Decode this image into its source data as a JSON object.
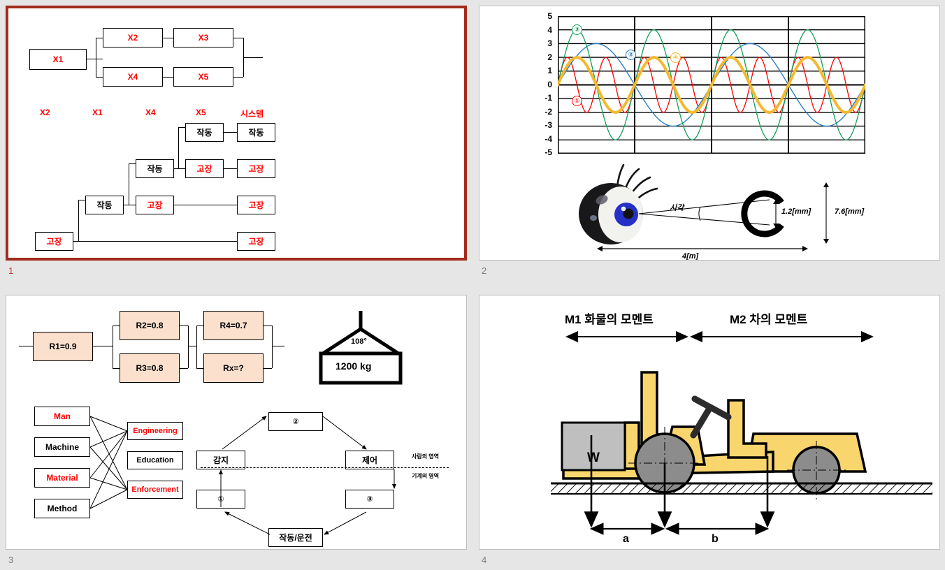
{
  "app": {
    "view": "slide-sorter",
    "background": "#e6e6e6",
    "selection_color": "#a32b1c"
  },
  "slides": [
    {
      "number": "1",
      "selected": true,
      "title": "Reliability block diagram and fault tree",
      "rbd": {
        "blocks": [
          "X1",
          "X2",
          "X3",
          "X4",
          "X5"
        ],
        "text_color": "#ff0000"
      },
      "tree": {
        "headers": [
          "X2",
          "X1",
          "X4",
          "X5",
          "시스템"
        ],
        "ok_label": "작동",
        "fail_label": "고장",
        "nodes": [
          {
            "col": "X5",
            "label": "작동",
            "state": "ok"
          },
          {
            "col": "system",
            "label": "작동",
            "state": "ok"
          },
          {
            "col": "X4",
            "label": "작동",
            "state": "ok"
          },
          {
            "col": "X5",
            "label": "고장",
            "state": "fail"
          },
          {
            "col": "system",
            "label": "고장",
            "state": "fail"
          },
          {
            "col": "X1",
            "label": "작동",
            "state": "ok"
          },
          {
            "col": "X4",
            "label": "고장",
            "state": "fail"
          },
          {
            "col": "system",
            "label": "고장",
            "state": "fail"
          },
          {
            "col": "X2",
            "label": "고장",
            "state": "fail"
          },
          {
            "col": "system",
            "label": "고장",
            "state": "fail"
          }
        ]
      }
    },
    {
      "number": "2",
      "selected": false,
      "title": "Waveforms and visual angle",
      "eye": {
        "angle_label": "시각",
        "gap_label": "1.2[mm]",
        "ring_label": "7.6[mm]",
        "distance_label": "4[m]"
      }
    },
    {
      "number": "3",
      "selected": false,
      "title": "Reliability network, sling load and 4M-3E",
      "rbd": {
        "blocks": [
          {
            "id": "R1",
            "label": "R1=0.9"
          },
          {
            "id": "R2",
            "label": "R2=0.8"
          },
          {
            "id": "R3",
            "label": "R3=0.8"
          },
          {
            "id": "R4",
            "label": "R4=0.7"
          },
          {
            "id": "Rx",
            "label": "Rx=?"
          }
        ]
      },
      "sling": {
        "angle": "108°",
        "load": "1200 kg"
      },
      "fourm": {
        "left": [
          {
            "label": "Man",
            "color": "#ff0000"
          },
          {
            "label": "Machine",
            "color": "#000000"
          },
          {
            "label": "Material",
            "color": "#ff0000"
          },
          {
            "label": "Method",
            "color": "#000000"
          }
        ],
        "right": [
          {
            "label": "Engineering",
            "color": "#ff0000"
          },
          {
            "label": "Education",
            "color": "#000000"
          },
          {
            "label": "Enforcement",
            "color": "#ff0000"
          }
        ]
      },
      "loop": {
        "top": "②",
        "left_upper": "감지",
        "right_upper": "제어",
        "left_lower": "①",
        "right_lower": "③",
        "bottom": "작동/운전",
        "human_zone": "사람의 영역",
        "machine_zone": "기계의 영역"
      }
    },
    {
      "number": "4",
      "selected": false,
      "title": "Forklift moment balance",
      "forklift": {
        "m1_label": "M1 화물의 모멘트",
        "m2_label": "M2 차의 모멘트",
        "load_label": "W",
        "dim_a": "a",
        "dim_b": "b",
        "body_color": "#f9d56e",
        "wheel_color": "#8c8c8c",
        "load_color": "#bfbfbf"
      }
    }
  ],
  "chart_data": {
    "type": "line",
    "title": "",
    "xlabel": "",
    "ylabel": "",
    "ylim": [
      -5,
      5
    ],
    "yticks": [
      5,
      4,
      3,
      2,
      1,
      0,
      -1,
      -2,
      -3,
      -4,
      -5
    ],
    "grid": true,
    "legend_position": "inline-annotations",
    "series": [
      {
        "name": "①",
        "label": "1",
        "color": "#ff0000",
        "amplitude": 2,
        "cycles": 8,
        "phase": 0,
        "width": 1.3
      },
      {
        "name": "②",
        "label": "2",
        "color": "#1f77c4",
        "amplitude": 3,
        "cycles": 2,
        "phase": 0,
        "width": 1.3
      },
      {
        "name": "③",
        "label": "3",
        "color": "#13a05c",
        "amplitude": 4,
        "cycles": 4,
        "phase": 0,
        "width": 1.3
      },
      {
        "name": "④",
        "label": "4",
        "color": "#ffc countries",
        "amplitude": 2,
        "cycles": 4,
        "phase": 0,
        "width": 4
      }
    ],
    "annotations": [
      {
        "text": "①",
        "color": "#ff0000"
      },
      {
        "text": "②",
        "color": "#1f77c4"
      },
      {
        "text": "③",
        "color": "#13a05c"
      },
      {
        "text": "④",
        "color": "#f5b82e"
      }
    ]
  }
}
